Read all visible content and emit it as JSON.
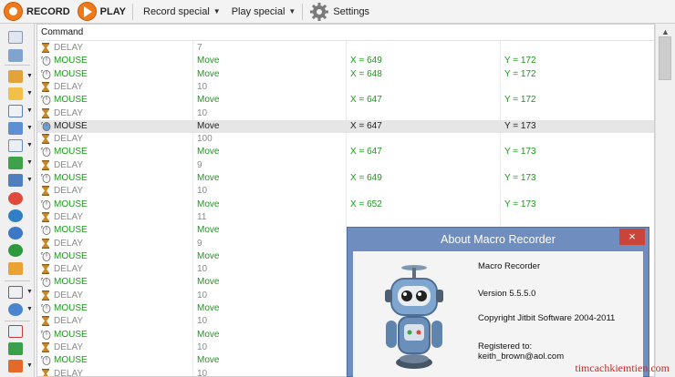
{
  "toolbar": {
    "record_label": "RECORD",
    "play_label": "PLAY",
    "record_special_label": "Record special",
    "play_special_label": "Play special",
    "settings_label": "Settings"
  },
  "grid": {
    "header": "Command",
    "rows": [
      {
        "icon": "hourglass-icon",
        "type": "DELAY",
        "action": "7",
        "x": "",
        "y": "",
        "color": "gray"
      },
      {
        "icon": "mouse-icon",
        "type": "MOUSE",
        "action": "Move",
        "x": "X = 649",
        "y": "Y = 172",
        "color": "green"
      },
      {
        "icon": "mouse-icon",
        "type": "MOUSE",
        "action": "Move",
        "x": "X = 648",
        "y": "Y = 172",
        "color": "green"
      },
      {
        "icon": "hourglass-icon",
        "type": "DELAY",
        "action": "10",
        "x": "",
        "y": "",
        "color": "gray"
      },
      {
        "icon": "mouse-icon",
        "type": "MOUSE",
        "action": "Move",
        "x": "X = 647",
        "y": "Y = 172",
        "color": "green"
      },
      {
        "icon": "hourglass-icon",
        "type": "DELAY",
        "action": "10",
        "x": "",
        "y": "",
        "color": "gray"
      },
      {
        "icon": "mouse-icon",
        "type": "MOUSE",
        "action": "Move",
        "x": "X = 647",
        "y": "Y = 173",
        "color": "dark",
        "selected": true
      },
      {
        "icon": "hourglass-icon",
        "type": "DELAY",
        "action": "100",
        "x": "",
        "y": "",
        "color": "gray"
      },
      {
        "icon": "mouse-icon",
        "type": "MOUSE",
        "action": "Move",
        "x": "X = 647",
        "y": "Y = 173",
        "color": "green"
      },
      {
        "icon": "hourglass-icon",
        "type": "DELAY",
        "action": "9",
        "x": "",
        "y": "",
        "color": "gray"
      },
      {
        "icon": "mouse-icon",
        "type": "MOUSE",
        "action": "Move",
        "x": "X = 649",
        "y": "Y = 173",
        "color": "green"
      },
      {
        "icon": "hourglass-icon",
        "type": "DELAY",
        "action": "10",
        "x": "",
        "y": "",
        "color": "gray"
      },
      {
        "icon": "mouse-icon",
        "type": "MOUSE",
        "action": "Move",
        "x": "X = 652",
        "y": "Y = 173",
        "color": "green"
      },
      {
        "icon": "hourglass-icon",
        "type": "DELAY",
        "action": "11",
        "x": "",
        "y": "",
        "color": "gray"
      },
      {
        "icon": "mouse-icon",
        "type": "MOUSE",
        "action": "Move",
        "x": "",
        "y": "",
        "color": "green"
      },
      {
        "icon": "hourglass-icon",
        "type": "DELAY",
        "action": "9",
        "x": "",
        "y": "",
        "color": "gray"
      },
      {
        "icon": "mouse-icon",
        "type": "MOUSE",
        "action": "Move",
        "x": "",
        "y": "",
        "color": "green"
      },
      {
        "icon": "hourglass-icon",
        "type": "DELAY",
        "action": "10",
        "x": "",
        "y": "",
        "color": "gray"
      },
      {
        "icon": "mouse-icon",
        "type": "MOUSE",
        "action": "Move",
        "x": "",
        "y": "",
        "color": "green"
      },
      {
        "icon": "hourglass-icon",
        "type": "DELAY",
        "action": "10",
        "x": "",
        "y": "",
        "color": "gray"
      },
      {
        "icon": "mouse-icon",
        "type": "MOUSE",
        "action": "Move",
        "x": "",
        "y": "",
        "color": "green"
      },
      {
        "icon": "hourglass-icon",
        "type": "DELAY",
        "action": "10",
        "x": "",
        "y": "",
        "color": "gray"
      },
      {
        "icon": "mouse-icon",
        "type": "MOUSE",
        "action": "Move",
        "x": "",
        "y": "",
        "color": "green"
      },
      {
        "icon": "hourglass-icon",
        "type": "DELAY",
        "action": "10",
        "x": "",
        "y": "",
        "color": "gray"
      },
      {
        "icon": "mouse-icon",
        "type": "MOUSE",
        "action": "Move",
        "x": "",
        "y": "",
        "color": "green"
      },
      {
        "icon": "hourglass-icon",
        "type": "DELAY",
        "action": "10",
        "x": "",
        "y": "",
        "color": "gray"
      }
    ]
  },
  "dialog": {
    "title": "About Macro Recorder",
    "close": "×",
    "product": "Macro Recorder",
    "version": "Version    5.5.5.0",
    "copyright": "Copyright Jitbit Software 2004-2011",
    "registered_label": "Registered to:",
    "registered_email": "keith_brown@aol.com"
  },
  "watermark": "timcachkiemtien.com",
  "colors": {
    "green": "#1a9a1a",
    "gray": "#8a8a8a",
    "accent": "#f07a1a",
    "dialog_frame": "#6f8dbf",
    "close": "#c9453a"
  }
}
